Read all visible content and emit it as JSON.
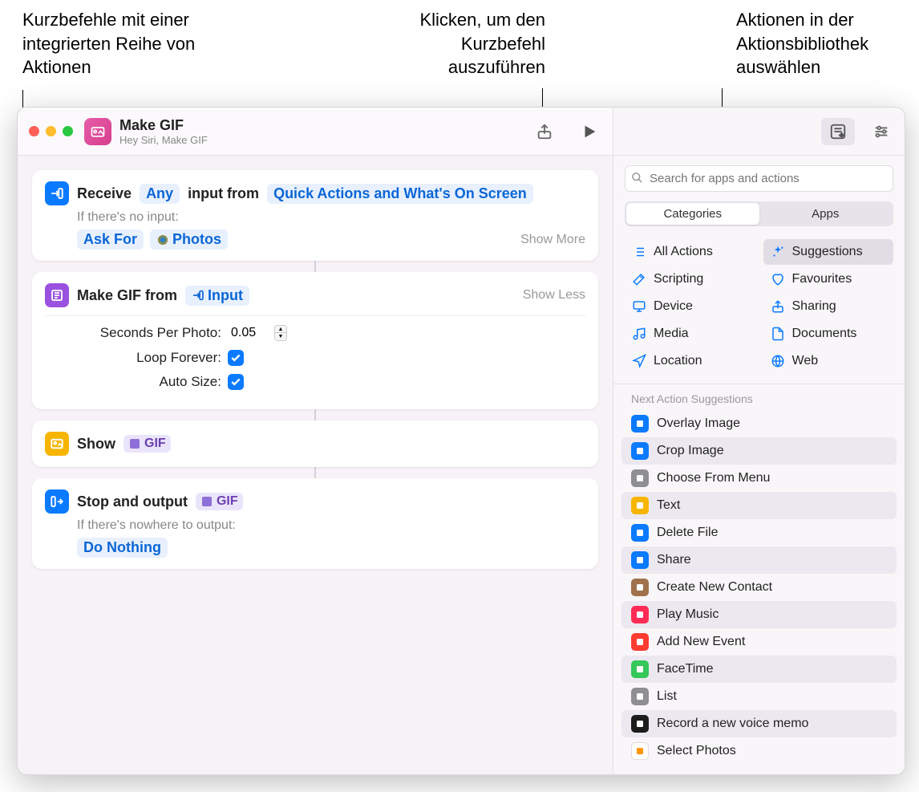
{
  "callouts": {
    "left": "Kurzbefehle mit einer integrierten Reihe von Aktionen",
    "middle": "Klicken, um den Kurzbefehl auszuführen",
    "right": "Aktionen in der Aktionsbibliothek auswählen"
  },
  "header": {
    "title": "Make GIF",
    "subtitle": "Hey Siri, Make GIF"
  },
  "actions": {
    "receive": {
      "prefix": "Receive",
      "token_any": "Any",
      "mid": "input from",
      "token_from": "Quick Actions and What's On Screen",
      "no_input_label": "If there's no input:",
      "ask_for": "Ask For",
      "photos": "Photos",
      "show_more": "Show More"
    },
    "make_gif": {
      "prefix": "Make GIF from",
      "token_input": "Input",
      "show_less": "Show Less",
      "seconds_label": "Seconds Per Photo:",
      "seconds_value": "0.05",
      "loop_label": "Loop Forever:",
      "auto_label": "Auto Size:"
    },
    "show": {
      "prefix": "Show",
      "token": "GIF"
    },
    "stop": {
      "prefix": "Stop and output",
      "token": "GIF",
      "nowhere_label": "If there's nowhere to output:",
      "do_nothing": "Do Nothing"
    }
  },
  "sidebar": {
    "search_placeholder": "Search for apps and actions",
    "tabs": {
      "categories": "Categories",
      "apps": "Apps"
    },
    "categories": [
      {
        "label": "All Actions",
        "color": "#0a7aff",
        "icon": "list"
      },
      {
        "label": "Suggestions",
        "color": "#0a7aff",
        "icon": "sparkle",
        "selected": true
      },
      {
        "label": "Scripting",
        "color": "#0a7aff",
        "icon": "wand"
      },
      {
        "label": "Favourites",
        "color": "#0a7aff",
        "icon": "heart"
      },
      {
        "label": "Device",
        "color": "#0a7aff",
        "icon": "device"
      },
      {
        "label": "Sharing",
        "color": "#0a7aff",
        "icon": "share"
      },
      {
        "label": "Media",
        "color": "#0a7aff",
        "icon": "music"
      },
      {
        "label": "Documents",
        "color": "#0a7aff",
        "icon": "doc"
      },
      {
        "label": "Location",
        "color": "#0a7aff",
        "icon": "location"
      },
      {
        "label": "Web",
        "color": "#0a7aff",
        "icon": "globe"
      }
    ],
    "suggestions_header": "Next Action Suggestions",
    "suggestions": [
      {
        "label": "Overlay Image",
        "bg": "#0a7aff"
      },
      {
        "label": "Crop Image",
        "bg": "#0a7aff"
      },
      {
        "label": "Choose From Menu",
        "bg": "#8e8e93"
      },
      {
        "label": "Text",
        "bg": "#f7b500"
      },
      {
        "label": "Delete File",
        "bg": "#0a7aff"
      },
      {
        "label": "Share",
        "bg": "#0a7aff"
      },
      {
        "label": "Create New Contact",
        "bg": "#a0714b"
      },
      {
        "label": "Play Music",
        "bg": "#ff2d55"
      },
      {
        "label": "Add New Event",
        "bg": "#ff3b30"
      },
      {
        "label": "FaceTime",
        "bg": "#34c759"
      },
      {
        "label": "List",
        "bg": "#8e8e93"
      },
      {
        "label": "Record a new voice memo",
        "bg": "#1c1c1e"
      },
      {
        "label": "Select Photos",
        "bg": "#ffffff"
      }
    ]
  }
}
